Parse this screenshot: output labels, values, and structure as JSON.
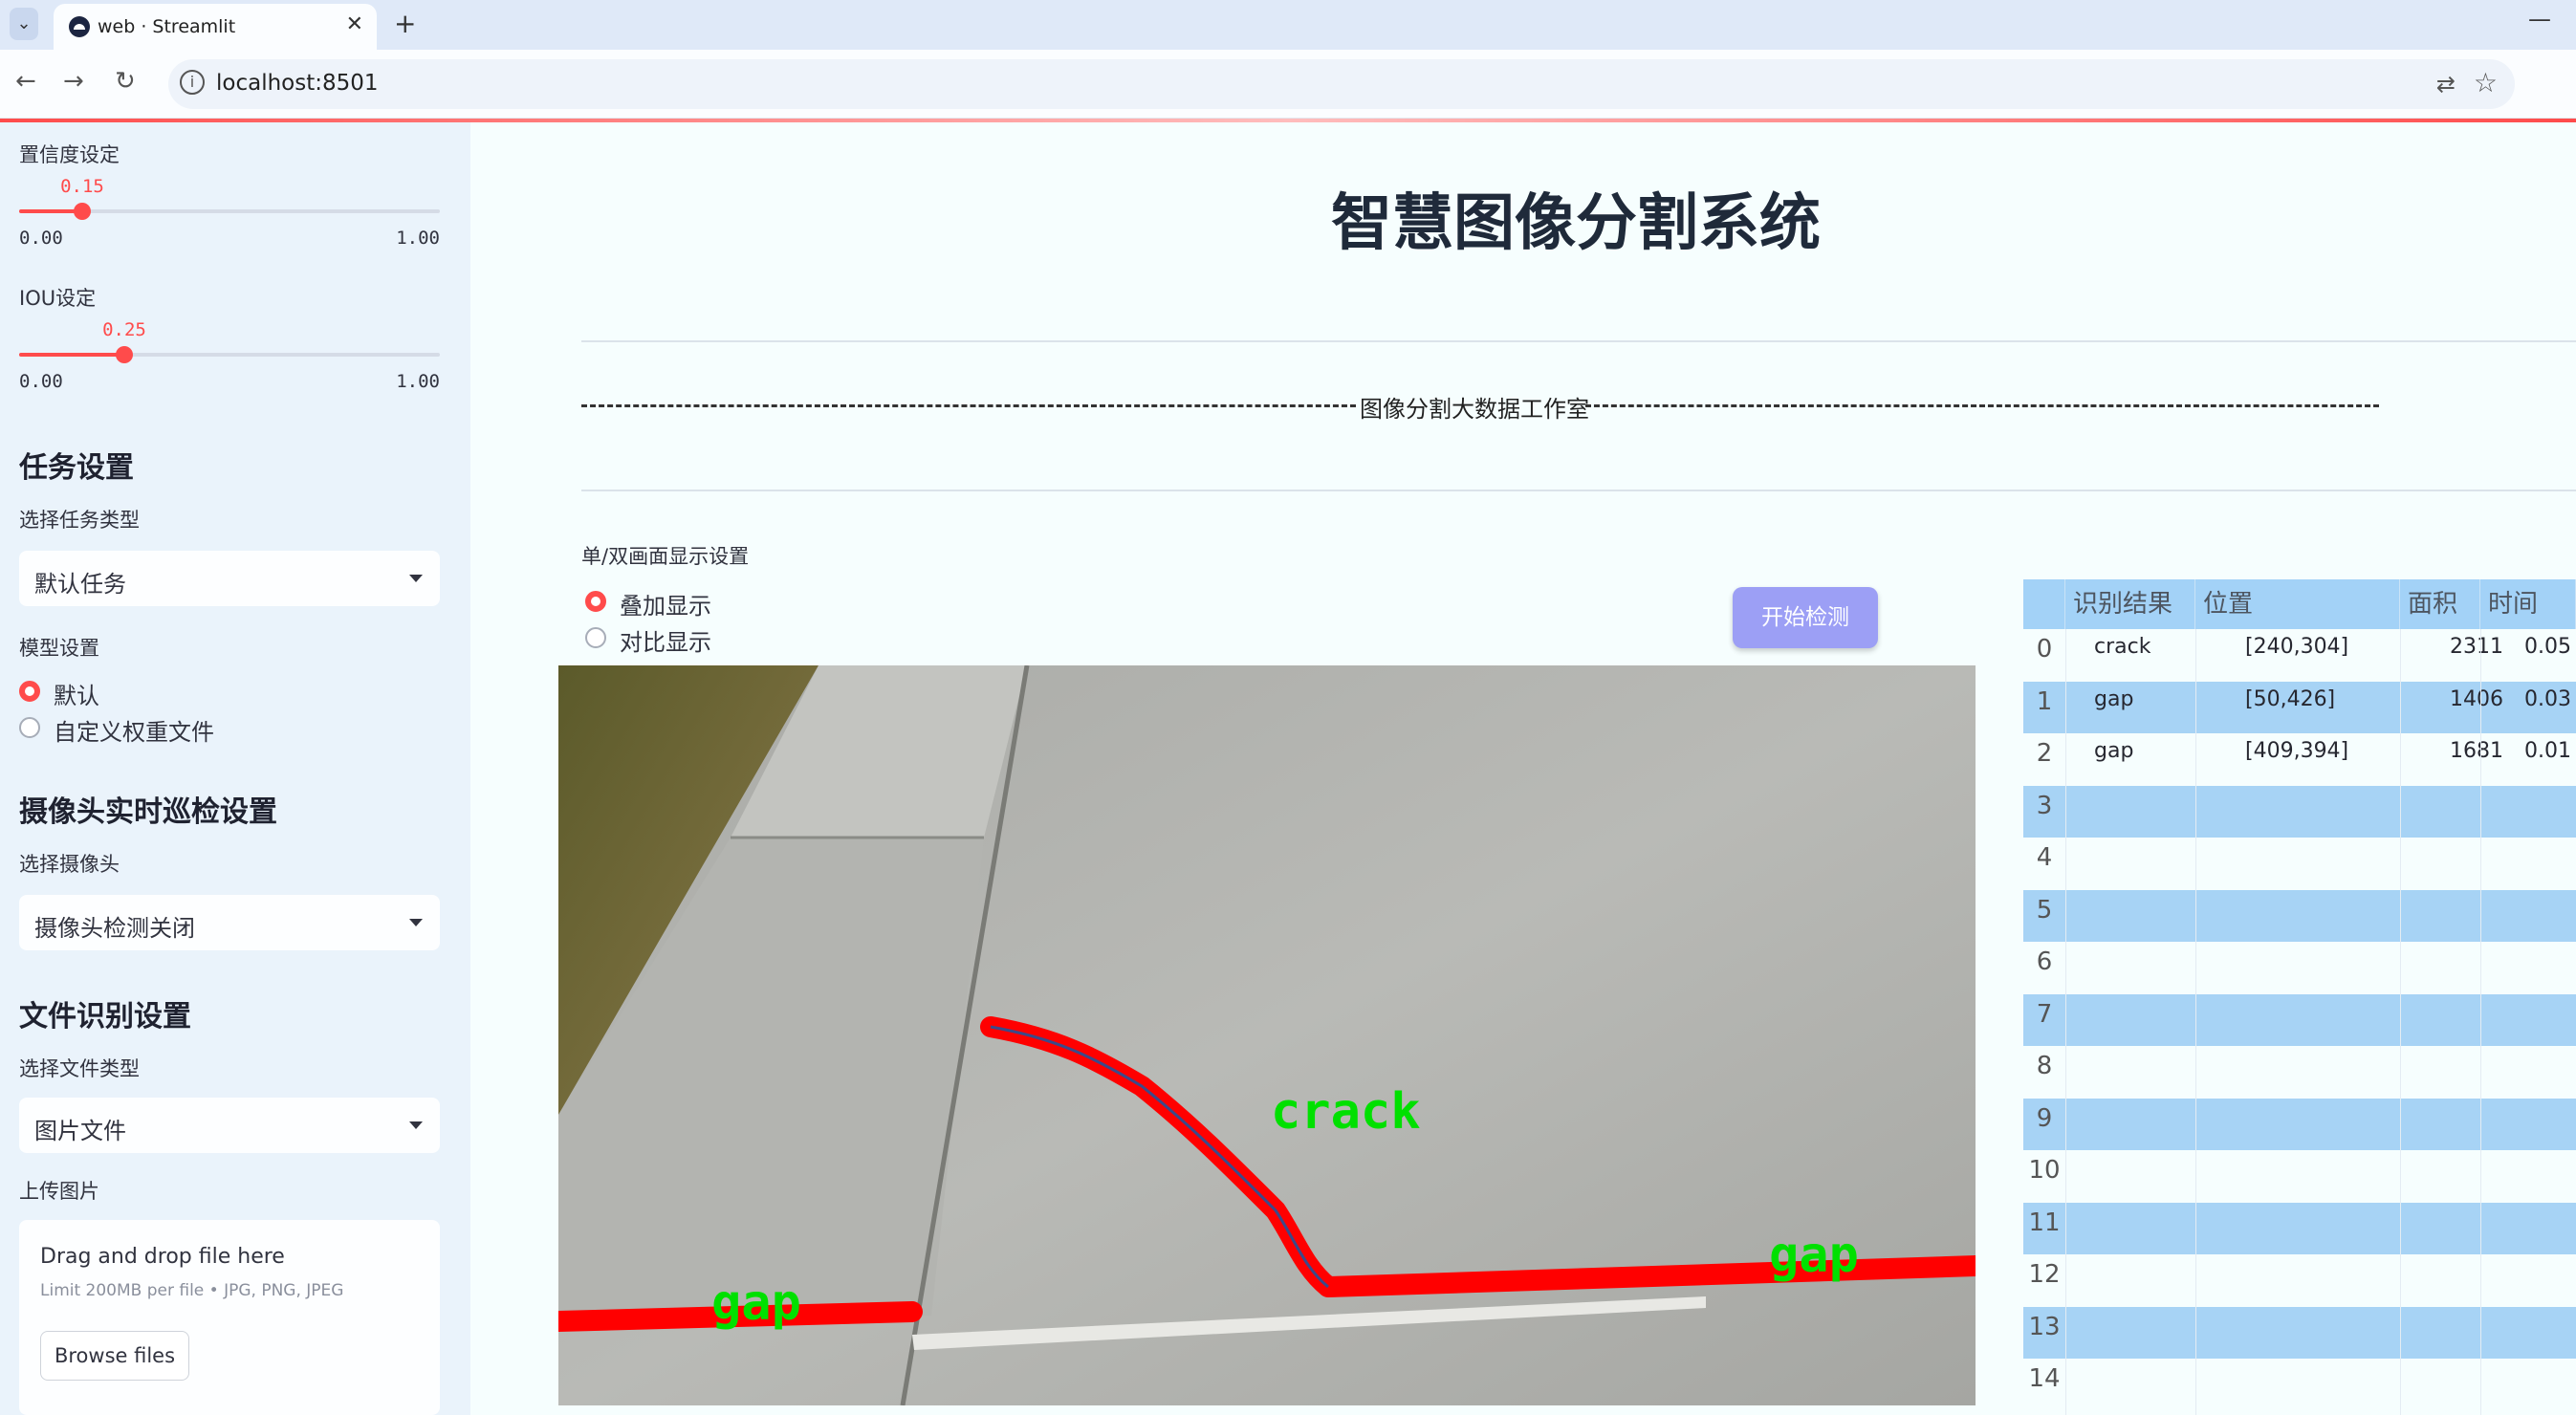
{
  "browser": {
    "tab_title": "web · Streamlit",
    "url": "localhost:8501"
  },
  "sidebar": {
    "confidence_label": "置信度设定",
    "confidence": {
      "value": "0.15",
      "min": "0.00",
      "max": "1.00",
      "fraction": 0.15
    },
    "iou_label": "IOU设定",
    "iou": {
      "value": "0.25",
      "min": "0.00",
      "max": "1.00",
      "fraction": 0.25
    },
    "task_section": "任务设置",
    "task_type_label": "选择任务类型",
    "task_type_value": "默认任务",
    "model_label": "模型设置",
    "model_options": [
      "默认",
      "自定义权重文件"
    ],
    "model_selected": 0,
    "camera_section": "摄像头实时巡检设置",
    "camera_label": "选择摄像头",
    "camera_value": "摄像头检测关闭",
    "file_section": "文件识别设置",
    "file_type_label": "选择文件类型",
    "file_type_value": "图片文件",
    "upload_label": "上传图片",
    "upload_title": "Drag and drop file here",
    "upload_sub": "Limit 200MB per file • JPG, PNG, JPEG",
    "browse_label": "Browse files"
  },
  "main": {
    "title": "智慧图像分割系统",
    "banner": "图像分割大数据工作室",
    "display_label": "单/双画面显示设置",
    "display_options": [
      "叠加显示",
      "对比显示"
    ],
    "display_selected": 0,
    "start_button": "开始检测"
  },
  "detections": {
    "labels": [
      "crack",
      "gap",
      "gap"
    ]
  },
  "results_table": {
    "headers": [
      "识别结果",
      "位置",
      "面积",
      "时间"
    ],
    "rows": [
      {
        "idx": "0",
        "label": "crack",
        "pos": "[240,304]",
        "area": "2311",
        "time": "0.05"
      },
      {
        "idx": "1",
        "label": "gap",
        "pos": "[50,426]",
        "area": "1406",
        "time": "0.03"
      },
      {
        "idx": "2",
        "label": "gap",
        "pos": "[409,394]",
        "area": "1681",
        "time": "0.01"
      },
      {
        "idx": "3"
      },
      {
        "idx": "4"
      },
      {
        "idx": "5"
      },
      {
        "idx": "6"
      },
      {
        "idx": "7"
      },
      {
        "idx": "8"
      },
      {
        "idx": "9"
      },
      {
        "idx": "10"
      },
      {
        "idx": "11"
      },
      {
        "idx": "12"
      },
      {
        "idx": "13"
      },
      {
        "idx": "14"
      }
    ]
  },
  "colors": {
    "accent": "#ff4b4b",
    "button": "#9c9ff5",
    "table_header": "#a3d2f7",
    "mask": "#ff0000",
    "label_text": "#00e000"
  }
}
